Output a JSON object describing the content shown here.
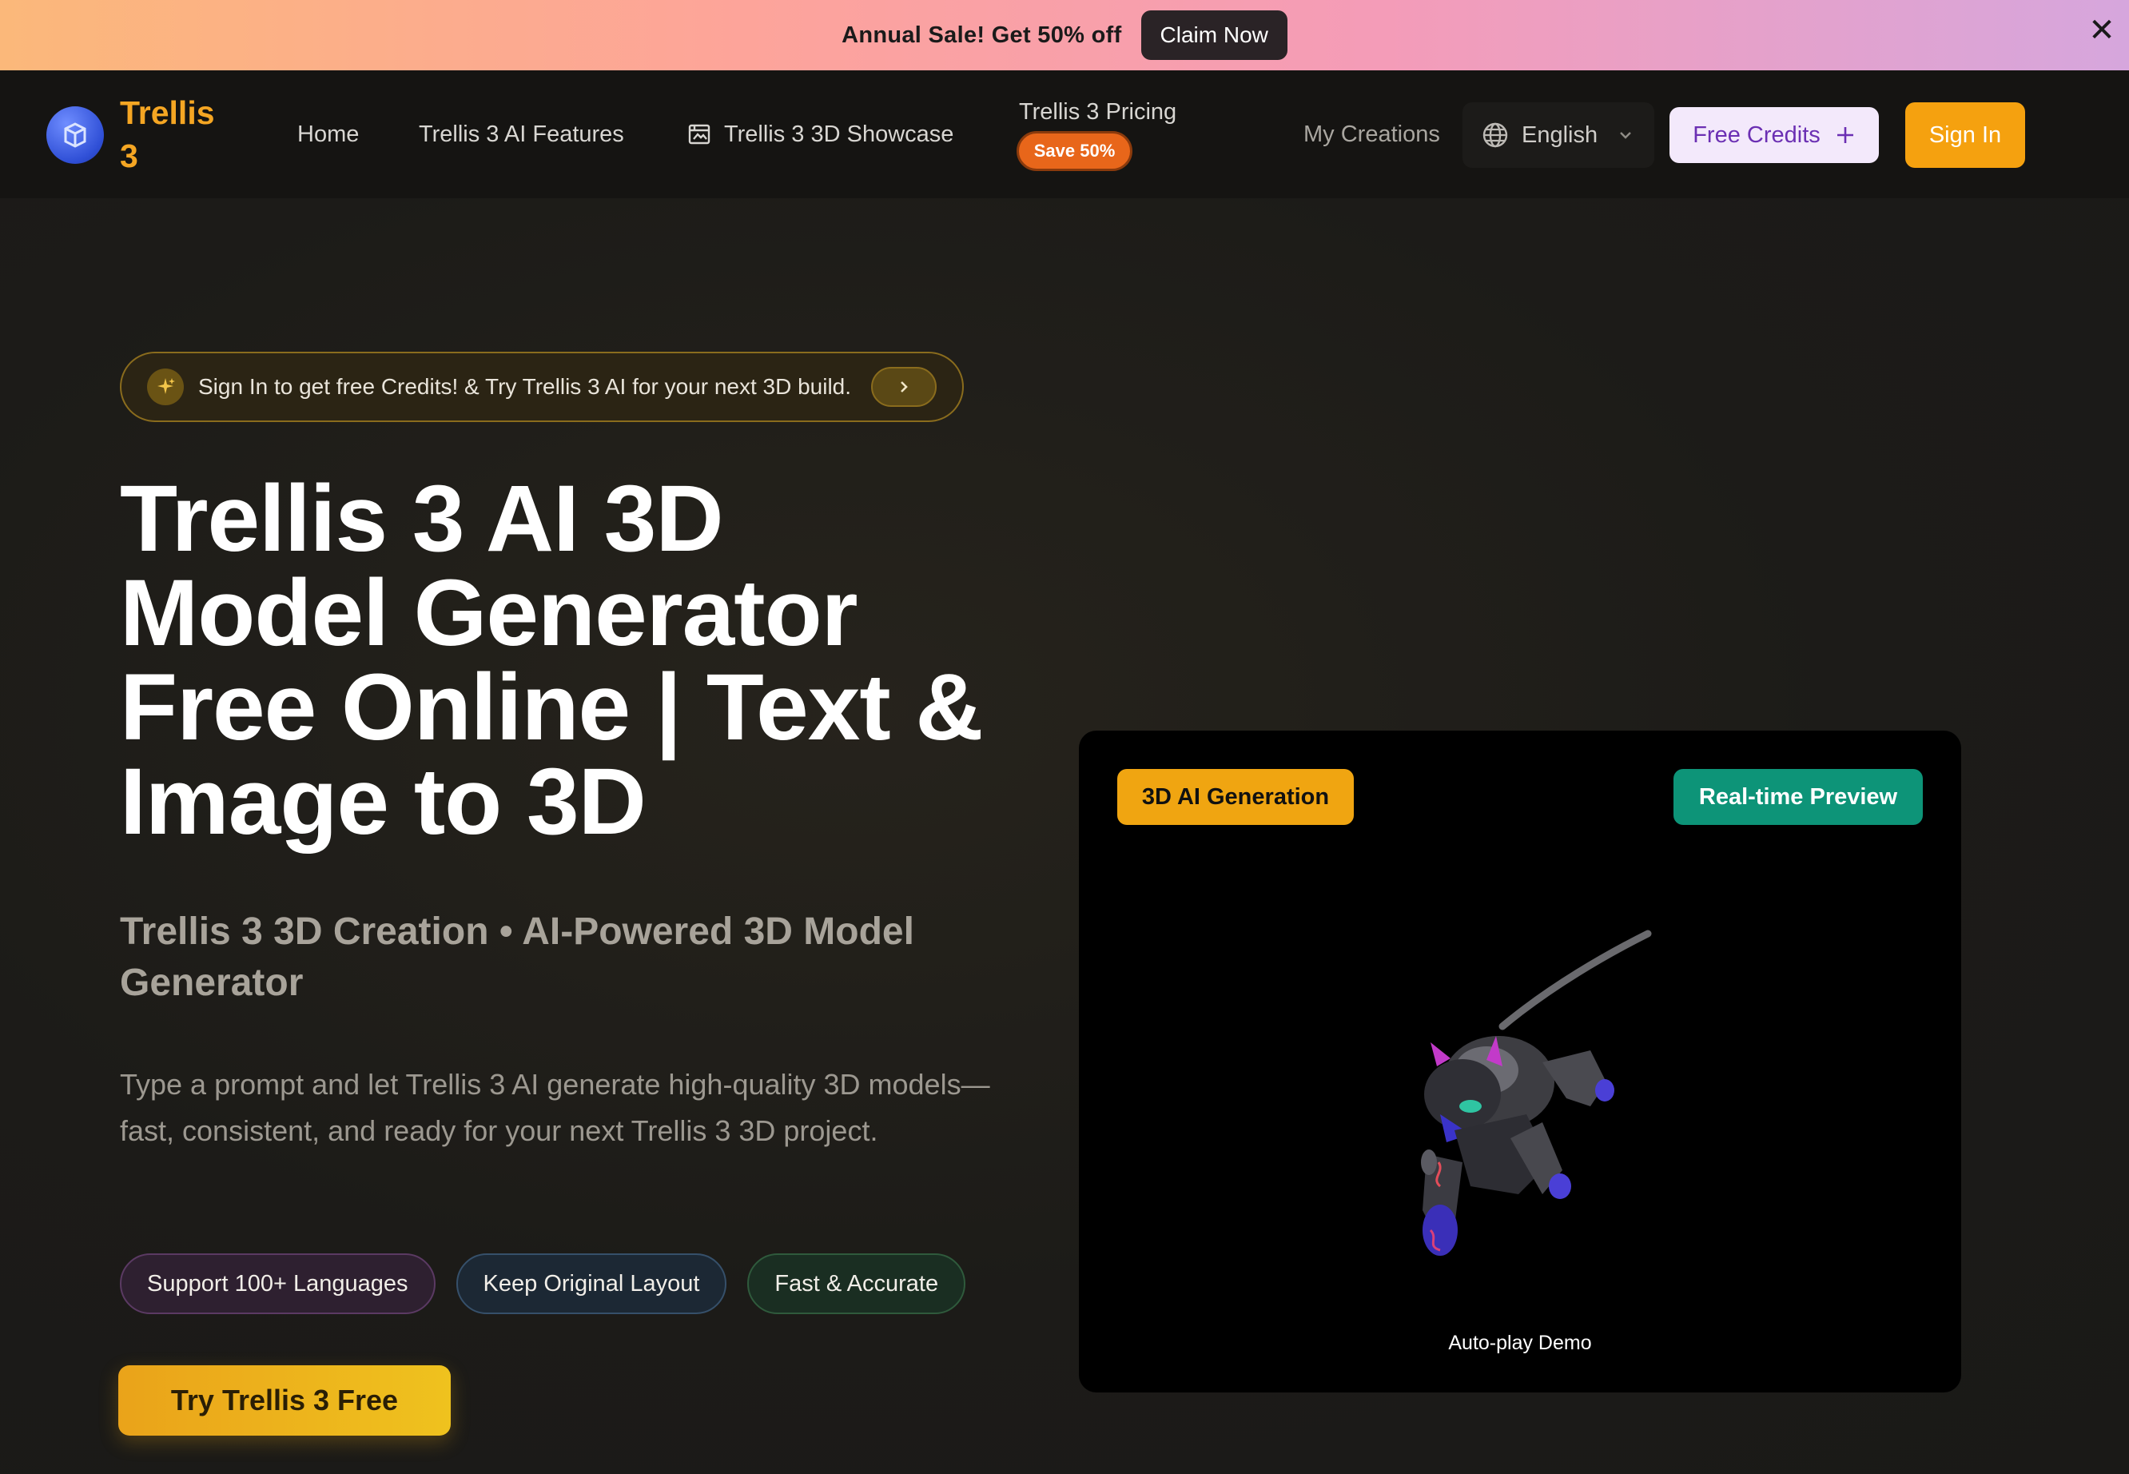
{
  "promo": {
    "text": "Annual Sale! Get 50% off",
    "button": "Claim Now",
    "close": "✕"
  },
  "nav": {
    "brand": "Trellis 3",
    "links": {
      "home": "Home",
      "features": "Trellis 3 AI Features",
      "showcase": "Trellis 3 3D Showcase",
      "pricing": "Trellis 3 Pricing",
      "pricing_badge": "Save 50%",
      "creations": "My Creations"
    },
    "language": "English",
    "free_credits": "Free Credits",
    "sign_in": "Sign In"
  },
  "hero": {
    "pill_text": "Sign In to get free Credits! & Try Trellis 3 AI for your next 3D build.",
    "headline": "Trellis 3 AI 3D Model Generator Free Online | Text & Image to 3D",
    "subhead": "Trellis 3 3D Creation • AI-Powered 3D Model Generator",
    "description": "Type a prompt and let Trellis 3 AI generate high-quality 3D models—fast, consistent, and ready for your next Trellis 3 3D project.",
    "tags": [
      "Support 100+ Languages",
      "Keep Original Layout",
      "Fast & Accurate"
    ],
    "cta": "Try Trellis 3 Free"
  },
  "preview": {
    "badge_left": "3D AI Generation",
    "badge_right": "Real-time Preview",
    "caption": "Auto-play Demo"
  },
  "colors": {
    "accent": "#f5a10f",
    "brand": "#f5a623",
    "teal": "#0d9478",
    "purple_text": "#6b2fb3"
  },
  "icons": [
    "cube-logo-icon",
    "showcase-icon",
    "globe-icon",
    "chevron-down-icon",
    "plus-icon",
    "sparkle-icon",
    "chevron-right-icon",
    "close-icon"
  ]
}
